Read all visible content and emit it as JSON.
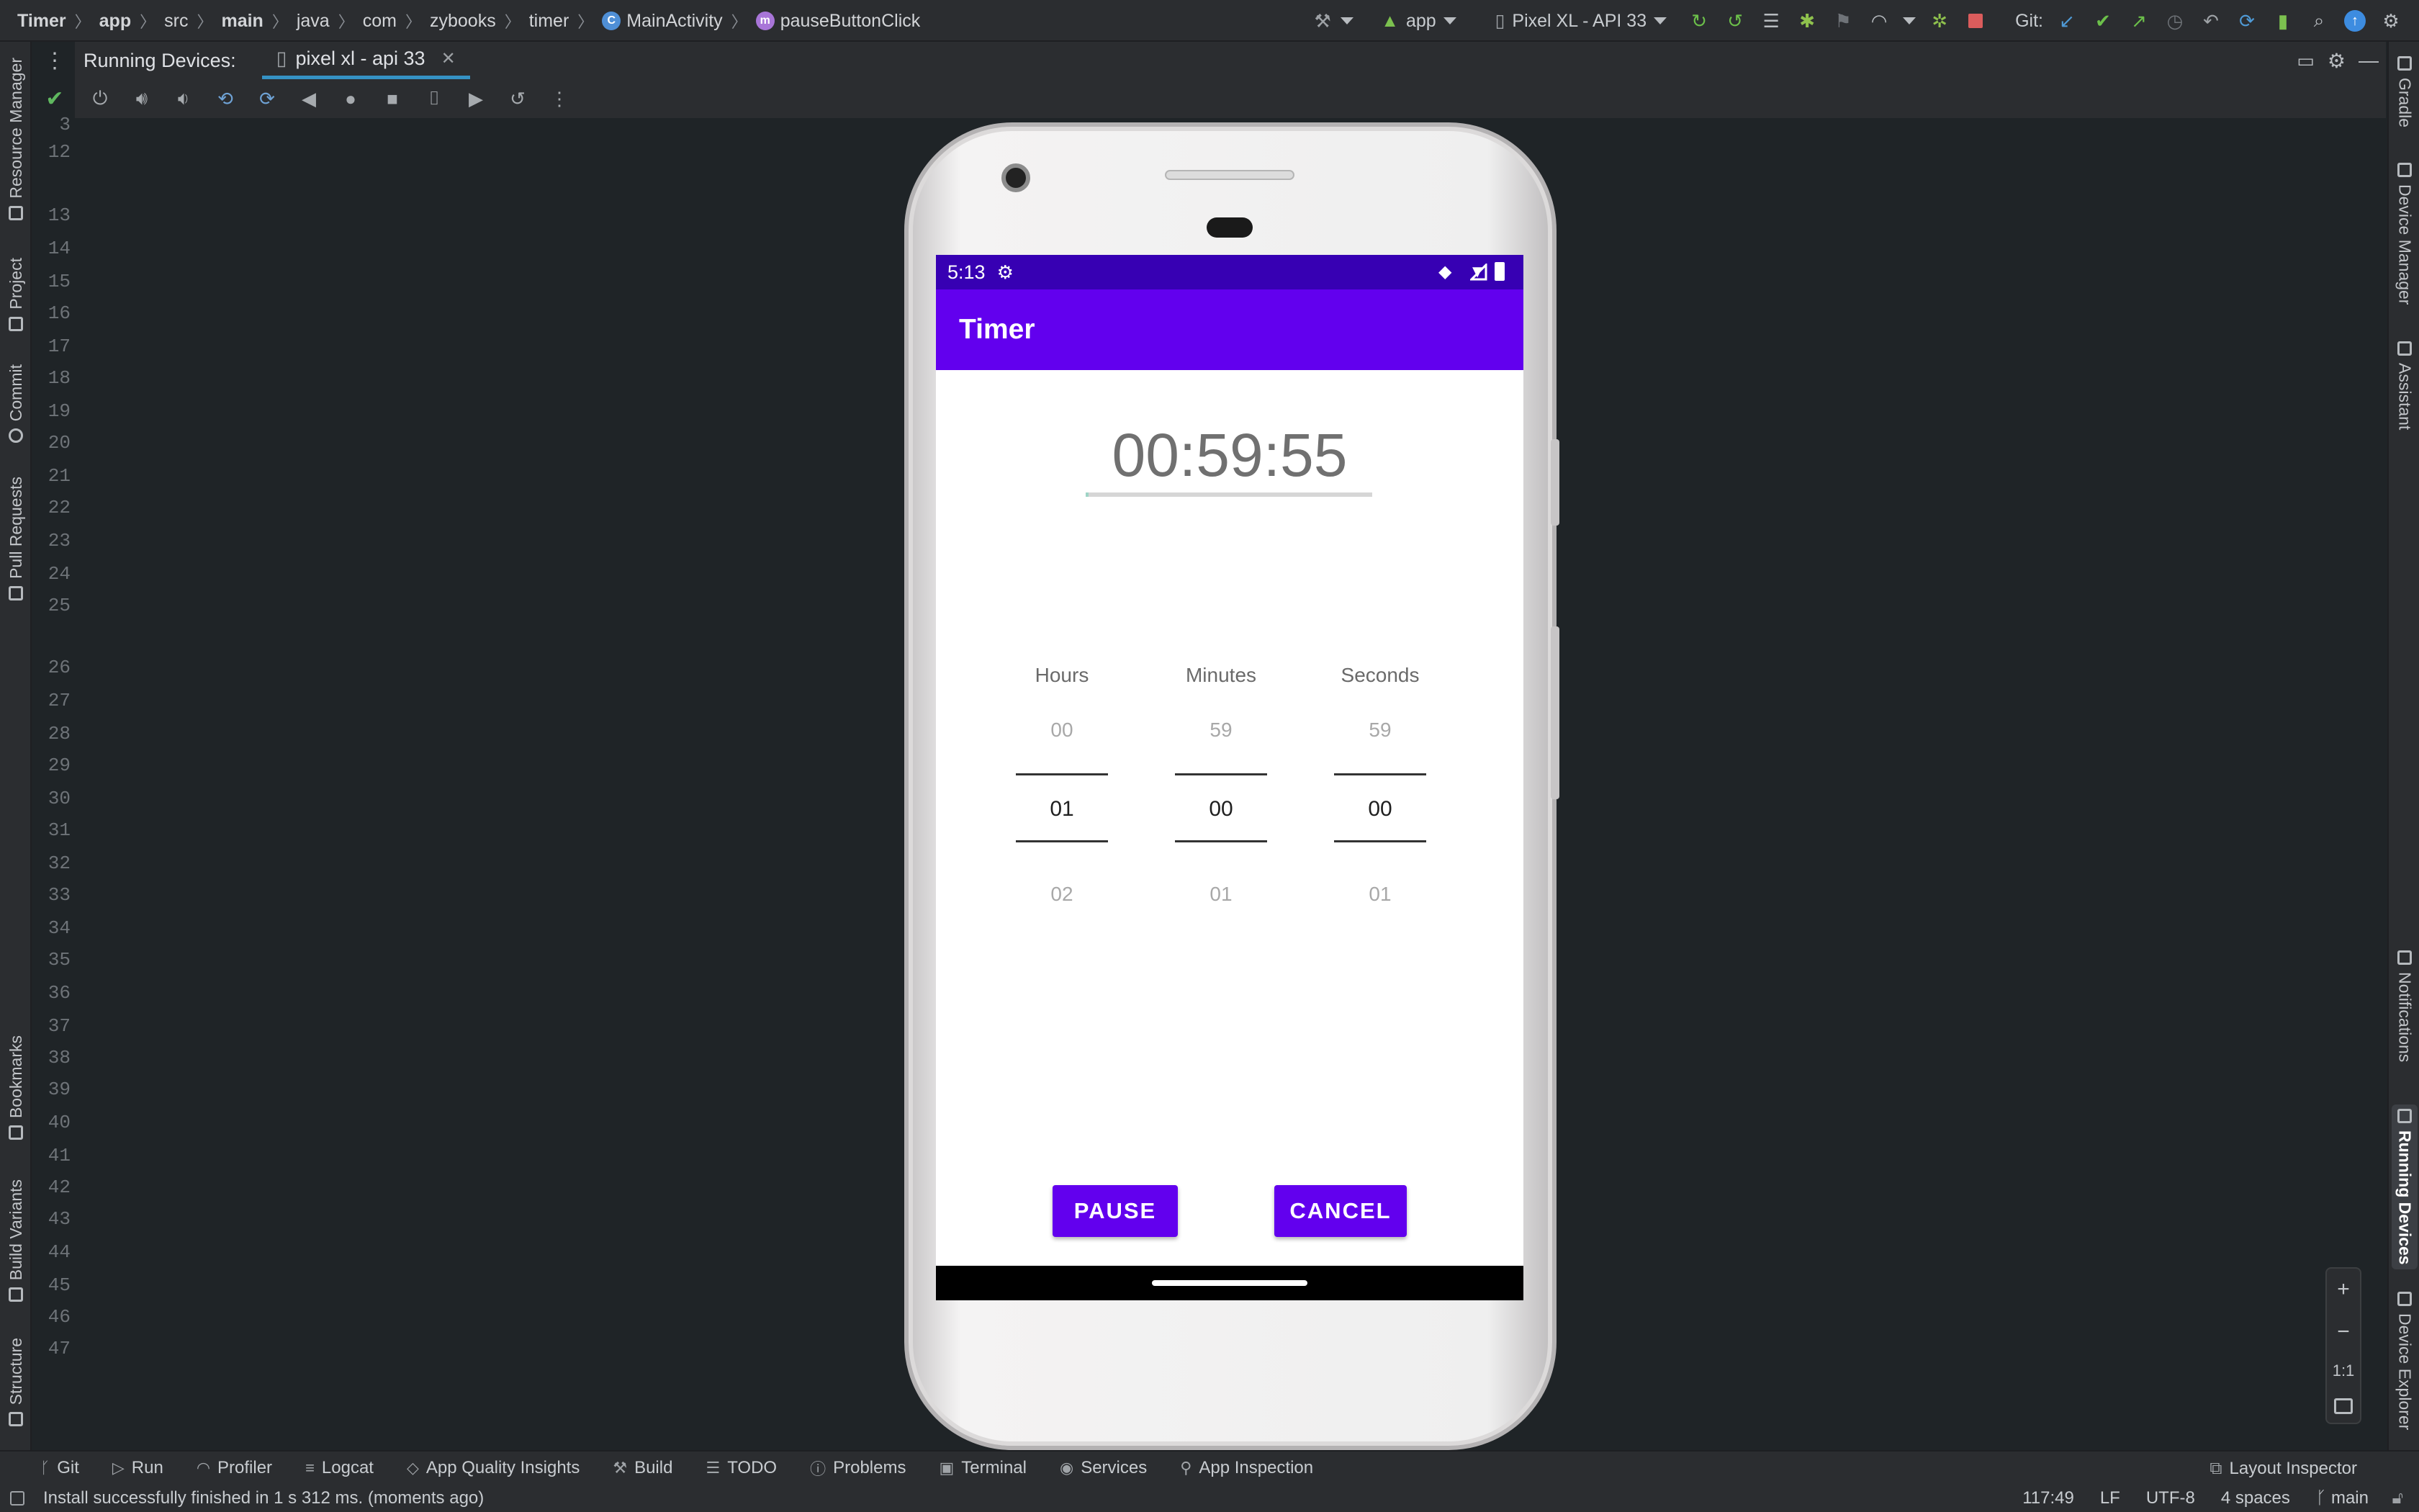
{
  "breadcrumb": [
    "Timer",
    "app",
    "src",
    "main",
    "java",
    "com",
    "zybooks",
    "timer",
    "MainActivity",
    "pauseButtonClick"
  ],
  "toolbar": {
    "run_config": "app",
    "device": "Pixel XL - API 33",
    "git_label": "Git:"
  },
  "left_tools": [
    "Resource Manager",
    "Project",
    "Commit",
    "Pull Requests",
    "Bookmarks",
    "Build Variants",
    "Structure"
  ],
  "right_tools": [
    "Gradle",
    "Device Manager",
    "Assistant",
    "Notifications",
    "Running Devices",
    "Device Explorer"
  ],
  "panel": {
    "title": "Running Devices:",
    "device_tab": "pixel xl - api 33"
  },
  "line_numbers": [
    "3",
    "12",
    "13",
    "14",
    "15",
    "16",
    "17",
    "18",
    "19",
    "20",
    "21",
    "22",
    "23",
    "24",
    "25",
    "26",
    "27",
    "28",
    "29",
    "30",
    "31",
    "32",
    "33",
    "34",
    "35",
    "36",
    "37",
    "38",
    "39",
    "40",
    "41",
    "42",
    "43",
    "44",
    "45",
    "46",
    "47"
  ],
  "device": {
    "status_time": "5:13",
    "app_title": "Timer",
    "timer_text": "00:59:55",
    "progress_fraction": 0.01,
    "pickers": [
      {
        "label": "Hours",
        "prev": "00",
        "value": "01",
        "next": "02"
      },
      {
        "label": "Minutes",
        "prev": "59",
        "value": "00",
        "next": "01"
      },
      {
        "label": "Seconds",
        "prev": "59",
        "value": "00",
        "next": "01"
      }
    ],
    "pause_label": "PAUSE",
    "cancel_label": "CANCEL"
  },
  "zoom": {
    "plus": "+",
    "minus": "−",
    "one_to_one": "1:1"
  },
  "bottom_tabs": [
    "Git",
    "Run",
    "Profiler",
    "Logcat",
    "App Quality Insights",
    "Build",
    "TODO",
    "Problems",
    "Terminal",
    "Services",
    "App Inspection"
  ],
  "layout_inspector": "Layout Inspector",
  "status": {
    "message": "Install successfully finished in 1 s 312 ms. (moments ago)",
    "position": "117:49",
    "line_sep": "LF",
    "encoding": "UTF-8",
    "indent": "4 spaces",
    "branch": "main"
  },
  "colors": {
    "primary": "#6200ee",
    "primary_dark": "#3700b3",
    "ide_bg": "#1f2427"
  }
}
